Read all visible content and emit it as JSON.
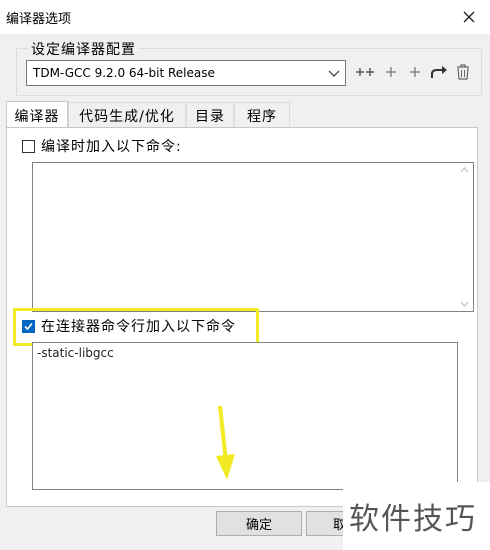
{
  "window": {
    "title": "编译器选项"
  },
  "compiler_config": {
    "group_label": "设定编译器配置",
    "selected": "TDM-GCC 9.2.0 64-bit Release"
  },
  "tabs": [
    {
      "label": "编译器",
      "active": true
    },
    {
      "label": "代码生成/优化",
      "active": false
    },
    {
      "label": "目录",
      "active": false
    },
    {
      "label": "程序",
      "active": false
    }
  ],
  "compile_cmd": {
    "label": "编译时加入以下命令:",
    "checked": false,
    "value": ""
  },
  "linker_cmd": {
    "label": "在连接器命令行加入以下命令",
    "checked": true,
    "value": "-static-libgcc"
  },
  "buttons": {
    "ok": "确定",
    "cancel": "取"
  },
  "watermark": {
    "text": "软件技巧"
  },
  "colors": {
    "highlight": "#f2ea22",
    "arrow": "#f2ea22",
    "checkbox": "#0067c0"
  }
}
